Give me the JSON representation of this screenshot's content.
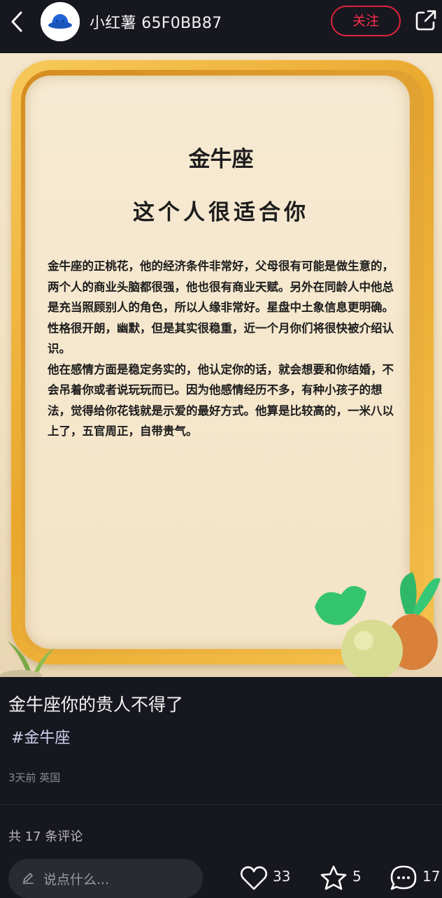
{
  "header": {
    "author_name": "小红薯 65F0BB87",
    "follow_label": "关注"
  },
  "post_image": {
    "title": "金牛座",
    "subtitle": "这个人很适合你",
    "paragraphs": [
      "金牛座的正桃花，他的经济条件非常好，父母很有可能是做生意的，两个人的商业头脑都很强，他也很有商业天赋。另外在同龄人中他总是充当照顾别人的角色，所以人缘非常好。星盘中土象信息更明确。性格很开朗，幽默，但是其实很稳重，近一个月你们将很快被介绍认识。",
      "他在感情方面是稳定务实的，他认定你的话，就会想要和你结婚，不会吊着你或者说玩玩而已。因为他感情经历不多，有种小孩子的想法，觉得给你花钱就是示爱的最好方式。他算是比较高的，一米八以上了，五官周正，自带贵气。"
    ]
  },
  "post": {
    "title": "金牛座你的贵人不得了",
    "hashtag": "#金牛座",
    "meta": "3天前 英国"
  },
  "comments": {
    "count_label": "共 17 条评论"
  },
  "bottom_bar": {
    "input_placeholder": "说点什么...",
    "likes": "33",
    "collects": "5",
    "comments": "17"
  },
  "icons": {
    "back": "chevron-left-icon",
    "share": "share-icon",
    "pencil": "pencil-icon",
    "like": "heart-icon",
    "collect": "star-icon",
    "comment": "comment-bubble-icon"
  },
  "colors": {
    "background": "#17171f",
    "follow_accent": "#ff2e4d",
    "hashtag": "#cfd4ee"
  }
}
